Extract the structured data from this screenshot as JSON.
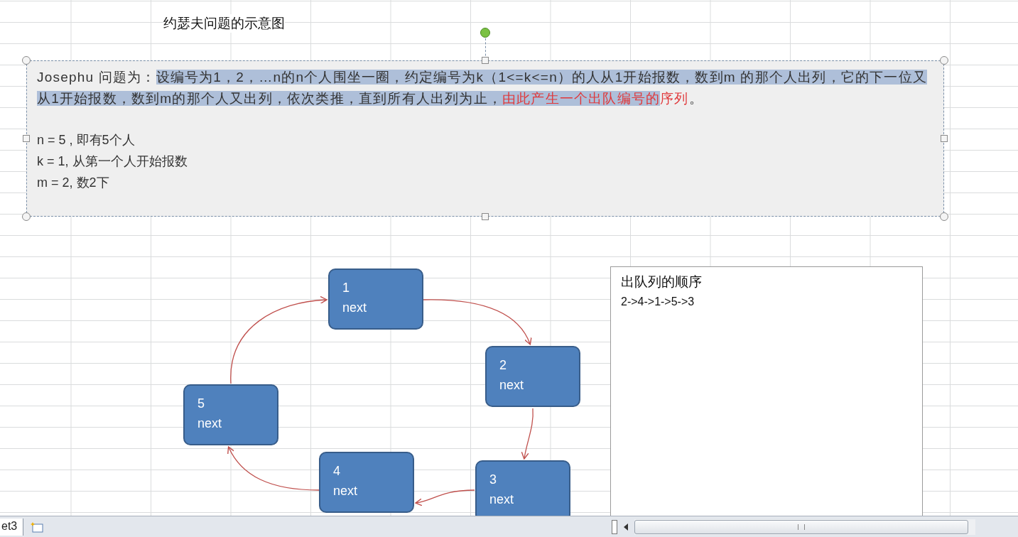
{
  "title": "约瑟夫问题的示意图",
  "textbox": {
    "paragraph": [
      {
        "text": "Josephu 问题为：",
        "selected": false,
        "red": false
      },
      {
        "text": "设编号为1，2，…n的n个人围坐一圈，约定编号为k（1<=k<=n）的人从1开始报数，数到m 的那个人出列，它的下一位又从1开始报数，数到m的那个人又出列，依次类推，直到所有人出列为止，",
        "selected": true,
        "red": false
      },
      {
        "text": "由此产生一个出队编号的",
        "selected": true,
        "red": true
      },
      {
        "text": "序列",
        "selected": false,
        "red": true
      },
      {
        "text": "。",
        "selected": false,
        "red": false
      }
    ],
    "lines": [
      "n = 5 , 即有5个人",
      "k = 1, 从第一个人开始报数",
      "m = 2, 数2下"
    ]
  },
  "nodes": [
    {
      "number": "1",
      "label": "next"
    },
    {
      "number": "2",
      "label": "next"
    },
    {
      "number": "3",
      "label": "next"
    },
    {
      "number": "4",
      "label": "next"
    },
    {
      "number": "5",
      "label": "next"
    }
  ],
  "result": {
    "heading": "出队列的顺序",
    "order": "2->4->1->5->3"
  },
  "sheet_tab": "et3"
}
